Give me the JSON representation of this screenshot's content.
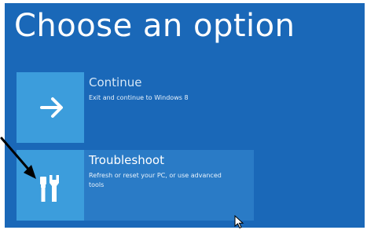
{
  "page": {
    "title": "Choose an option"
  },
  "options": [
    {
      "title": "Continue",
      "description": "Exit and continue to Windows 8",
      "icon": "arrow-right-icon"
    },
    {
      "title": "Troubleshoot",
      "description": "Refresh or reset your PC, or use advanced tools",
      "icon": "tools-icon"
    }
  ],
  "colors": {
    "background": "#1a68b8",
    "tile": "#3c9ddc",
    "selected_row": "#2a7bc6"
  }
}
